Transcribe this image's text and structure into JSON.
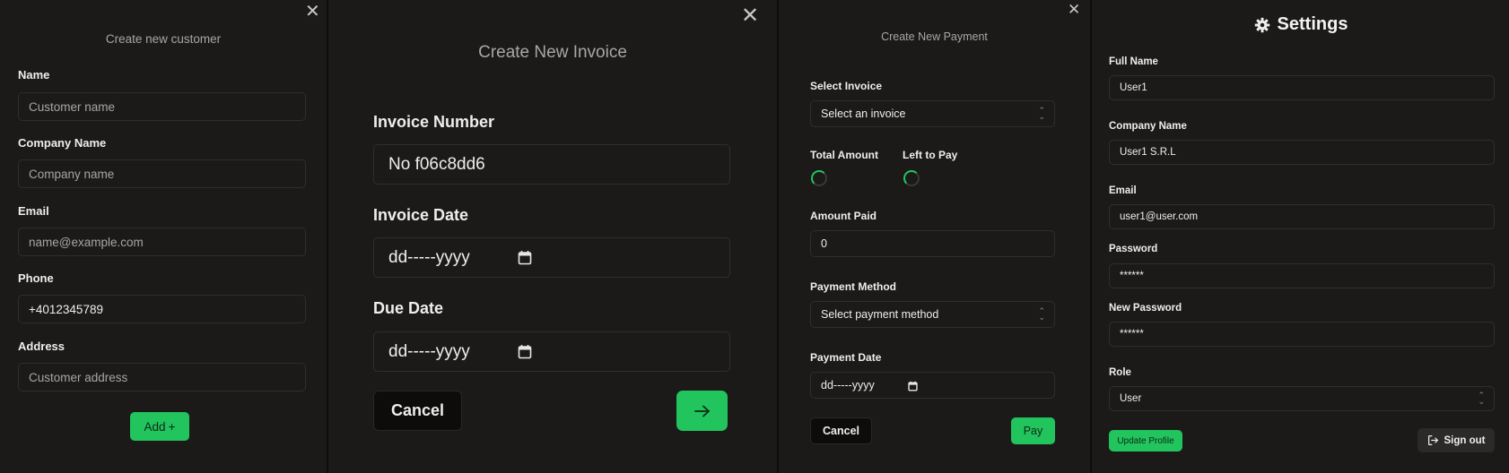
{
  "customer_form": {
    "title": "Create new customer",
    "fields": [
      {
        "label": "Name",
        "placeholder": "Customer name",
        "value": ""
      },
      {
        "label": "Company Name",
        "placeholder": "Company name",
        "value": ""
      },
      {
        "label": "Email",
        "placeholder": "name@example.com",
        "value": ""
      },
      {
        "label": "Phone",
        "placeholder": "",
        "value": "+4012345789"
      },
      {
        "label": "Address",
        "placeholder": "Customer address",
        "value": ""
      }
    ],
    "add_button": "Add",
    "add_icon": "+"
  },
  "invoice_form": {
    "title": "Create New Invoice",
    "number_label": "Invoice Number",
    "number_value": "No f06c8dd6",
    "invoice_date_label": "Invoice Date",
    "invoice_date_value": "dd-----yyyy",
    "due_date_label": "Due Date",
    "due_date_value": "dd-----yyyy",
    "cancel_button": "Cancel"
  },
  "payment_form": {
    "title": "Create New Payment",
    "invoice_label": "Select Invoice",
    "invoice_value": "Select an invoice",
    "total_label": "Total Amount",
    "left_label": "Left to Pay",
    "amount_label": "Amount Paid",
    "amount_value": "0",
    "method_label": "Payment Method",
    "method_value": "Select payment method",
    "date_label": "Payment Date",
    "date_value": "dd-----yyyy",
    "cancel_button": "Cancel",
    "pay_button": "Pay"
  },
  "settings": {
    "title": "Settings",
    "full_name_label": "Full Name",
    "full_name_value": "User1",
    "company_label": "Company Name",
    "company_value": "User1 S.R.L",
    "email_label": "Email",
    "email_value": "user1@user.com",
    "password_label": "Password",
    "password_value": "******",
    "new_password_label": "New Password",
    "new_password_value": "******",
    "role_label": "Role",
    "role_value": "User",
    "update_button": "Update Profile",
    "signout_button": "Sign out"
  },
  "colors": {
    "background": "#1c1a19",
    "accent_green": "#21c45d",
    "border": "#302d2b"
  }
}
